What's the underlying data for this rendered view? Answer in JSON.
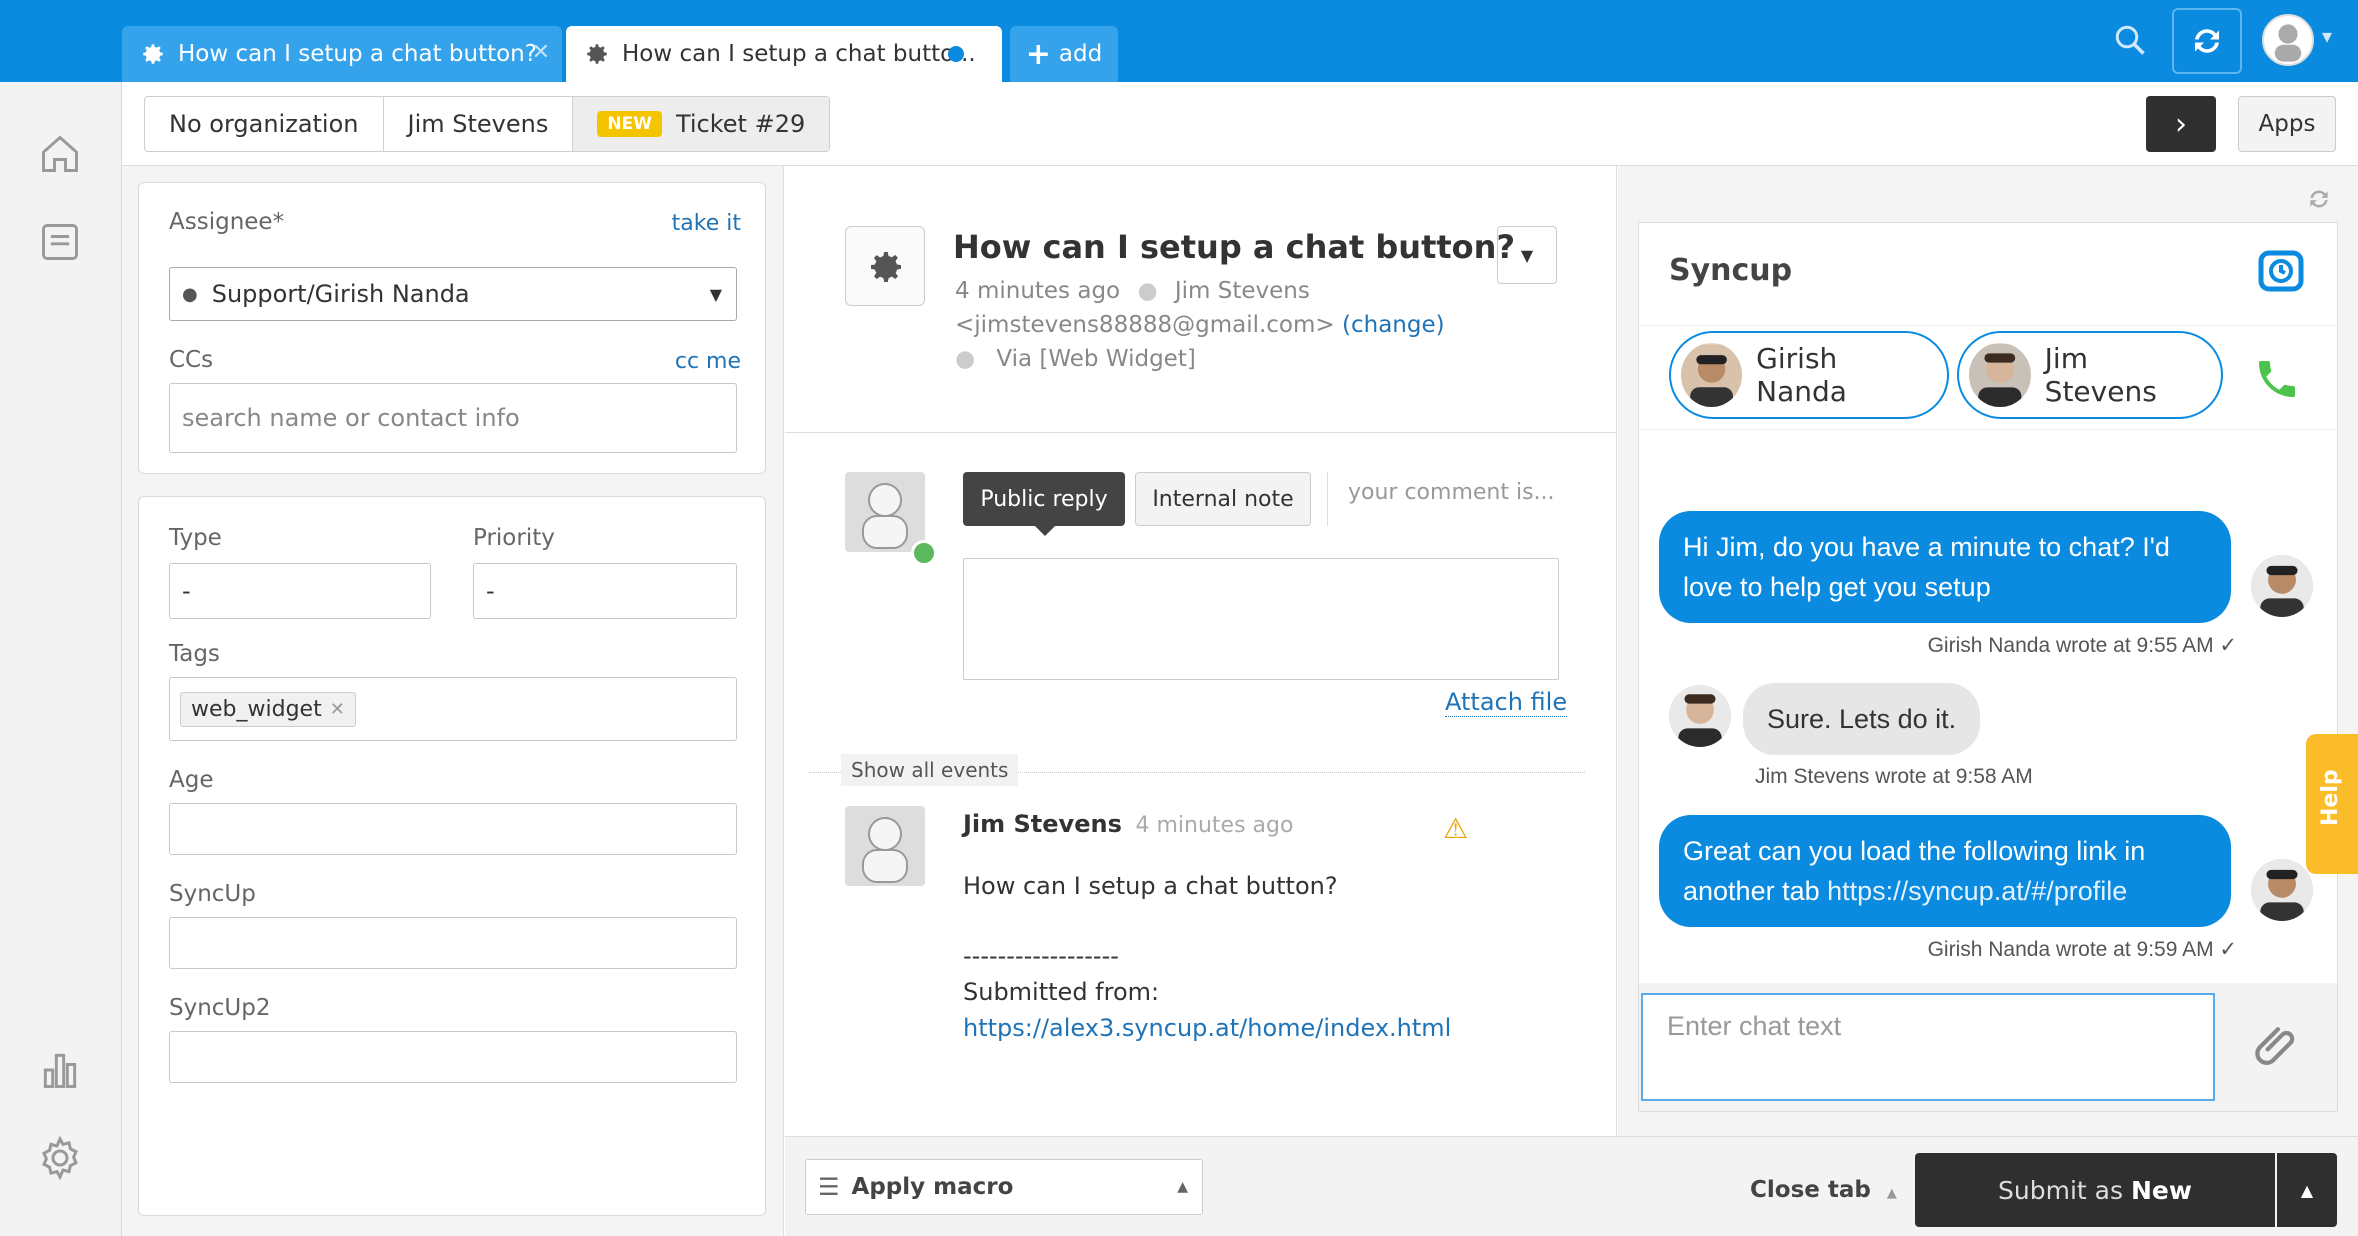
{
  "tabs": [
    {
      "label": "How can I setup a chat button?"
    },
    {
      "label": "How can I setup a chat butto..."
    },
    {
      "label": "add"
    }
  ],
  "breadcrumb": {
    "organization": "No organization",
    "requester": "Jim Stevens",
    "badge": "NEW",
    "ticket": "Ticket #29"
  },
  "header": {
    "apps_label": "Apps"
  },
  "fields": {
    "assignee_label": "Assignee*",
    "take_it": "take it",
    "assignee_value": "Support/Girish Nanda",
    "ccs_label": "CCs",
    "cc_me": "cc me",
    "cc_placeholder": "search name or contact info",
    "type_label": "Type",
    "type_value": "-",
    "priority_label": "Priority",
    "priority_value": "-",
    "tags_label": "Tags",
    "tag": "web_widget",
    "age_label": "Age",
    "syncup_label": "SyncUp",
    "syncup2_label": "SyncUp2"
  },
  "ticket": {
    "title": "How can I setup a chat button?",
    "time": "4 minutes ago",
    "requester": "Jim Stevens",
    "email": "<jimstevens88888@gmail.com>",
    "change": "(change)",
    "via": "Via [Web Widget]"
  },
  "composer": {
    "public_reply": "Public reply",
    "internal_note": "Internal note",
    "placeholder": "your comment is...",
    "attach": "Attach file",
    "show_events": "Show all events"
  },
  "event": {
    "author": "Jim Stevens",
    "time": "4 minutes ago",
    "body": "How can I setup a chat button?",
    "divider": "------------------",
    "submitted": "Submitted from:",
    "link": "https://alex3.syncup.at/home/index.html"
  },
  "syncup": {
    "title": "Syncup",
    "agent": "Girish Nanda",
    "customer": "Jim Stevens",
    "messages": [
      {
        "text": "Hi Jim, do you have a minute to chat? I'd love to help get you setup",
        "meta": "Girish Nanda wrote at 9:55 AM ✓"
      },
      {
        "text": "Sure. Lets do it.",
        "meta": "Jim Stevens wrote at 9:58 AM"
      },
      {
        "text_a": "Great can you load the following link in another tab ",
        "link": "https://syncup.at/#/profile",
        "meta": "Girish Nanda wrote at 9:59 AM ✓"
      }
    ],
    "input_placeholder": "Enter chat text",
    "help": "Help"
  },
  "footer": {
    "macro": "Apply macro",
    "close_tab": "Close tab",
    "submit_prefix": "Submit as ",
    "submit_status": "New"
  },
  "colors": {
    "brand": "#0a8be0",
    "submit": "#2f2f2f",
    "badge": "#f5c400"
  }
}
